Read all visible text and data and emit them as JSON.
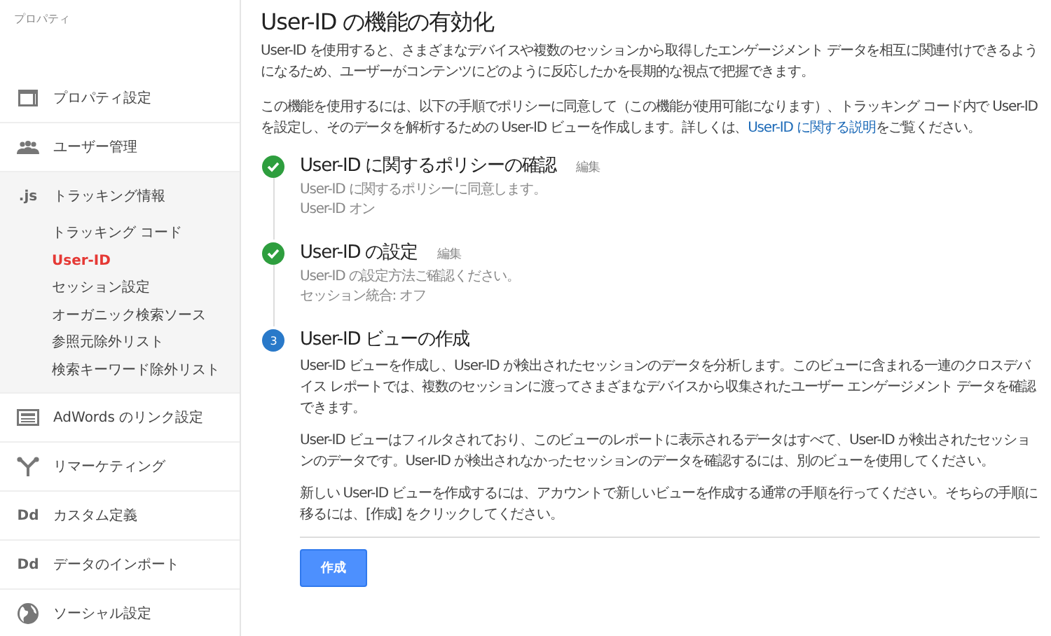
{
  "sidebar": {
    "header": "プロパティ",
    "items": [
      {
        "kind": "layout",
        "label": "プロパティ設定",
        "expanded": false
      },
      {
        "kind": "people",
        "label": "ユーザー管理",
        "expanded": false
      },
      {
        "kind": "glyph",
        "glyph": ".js",
        "label": "トラッキング情報",
        "expanded": true,
        "children": [
          {
            "label": "トラッキング コード",
            "selected": false
          },
          {
            "label": "User-ID",
            "selected": true
          },
          {
            "label": "セッション設定",
            "selected": false
          },
          {
            "label": "オーガニック検索ソース",
            "selected": false
          },
          {
            "label": "参照元除外リスト",
            "selected": false
          },
          {
            "label": "検索キーワード除外リスト",
            "selected": false
          }
        ]
      },
      {
        "kind": "card",
        "label": "AdWords のリンク設定",
        "expanded": false
      },
      {
        "kind": "fork",
        "label": "リマーケティング",
        "expanded": false
      },
      {
        "kind": "glyph",
        "glyph": "Dd",
        "label": "カスタム定義",
        "expanded": false
      },
      {
        "kind": "glyph",
        "glyph": "Dd",
        "label": "データのインポート",
        "expanded": false
      },
      {
        "kind": "globe",
        "label": "ソーシャル設定",
        "expanded": false
      }
    ]
  },
  "main": {
    "title": "User-ID の機能の有効化",
    "intro": "User-ID を使用すると、さまざまなデバイスや複数のセッションから取得したエンゲージメント データを相互に関連付けできるようになるため、ユーザーがコンテンツにどのように反応したかを長期的な視点で把握できます。",
    "instructions": {
      "text": "この機能を使用するには、以下の手順でポリシーに同意して（この機能が使用可能になります）、トラッキング コード内で User-ID を設定し、そのデータを解析するための User-ID ビューを作成します。詳しくは、",
      "link": "User-ID に関する説明",
      "after": "をご覧ください。"
    },
    "steps": [
      {
        "done": true,
        "title": "User-ID に関するポリシーの確認",
        "edit": "編集",
        "lines": [
          "User-ID に関するポリシーに同意します。",
          "User-ID オン"
        ]
      },
      {
        "done": true,
        "title": "User-ID の設定",
        "edit": "編集",
        "lines": [
          "User-ID の設定方法ご確認ください。",
          "セッション統合: オフ"
        ]
      },
      {
        "done": false,
        "number": "3",
        "title": "User-ID ビューの作成",
        "paragraphs": [
          "User-ID ビューを作成し、User-ID が検出されたセッションのデータを分析します。このビューに含まれる一連のクロスデバイス レポートでは、複数のセッションに渡ってさまざまなデバイスから収集されたユーザー エンゲージメント データを確認できます。",
          "User-ID ビューはフィルタされており、このビューのレポートに表示されるデータはすべて、User-ID が検出されたセッションのデータです。User-ID が検出されなかったセッションのデータを確認するには、別のビューを使用してください。",
          "新しい User-ID ビューを作成するには、アカウントで新しいビューを作成する通常の手順を行ってください。そちらの手順に移るには、[作成] をクリックしてください。"
        ],
        "button": "作成"
      }
    ]
  }
}
